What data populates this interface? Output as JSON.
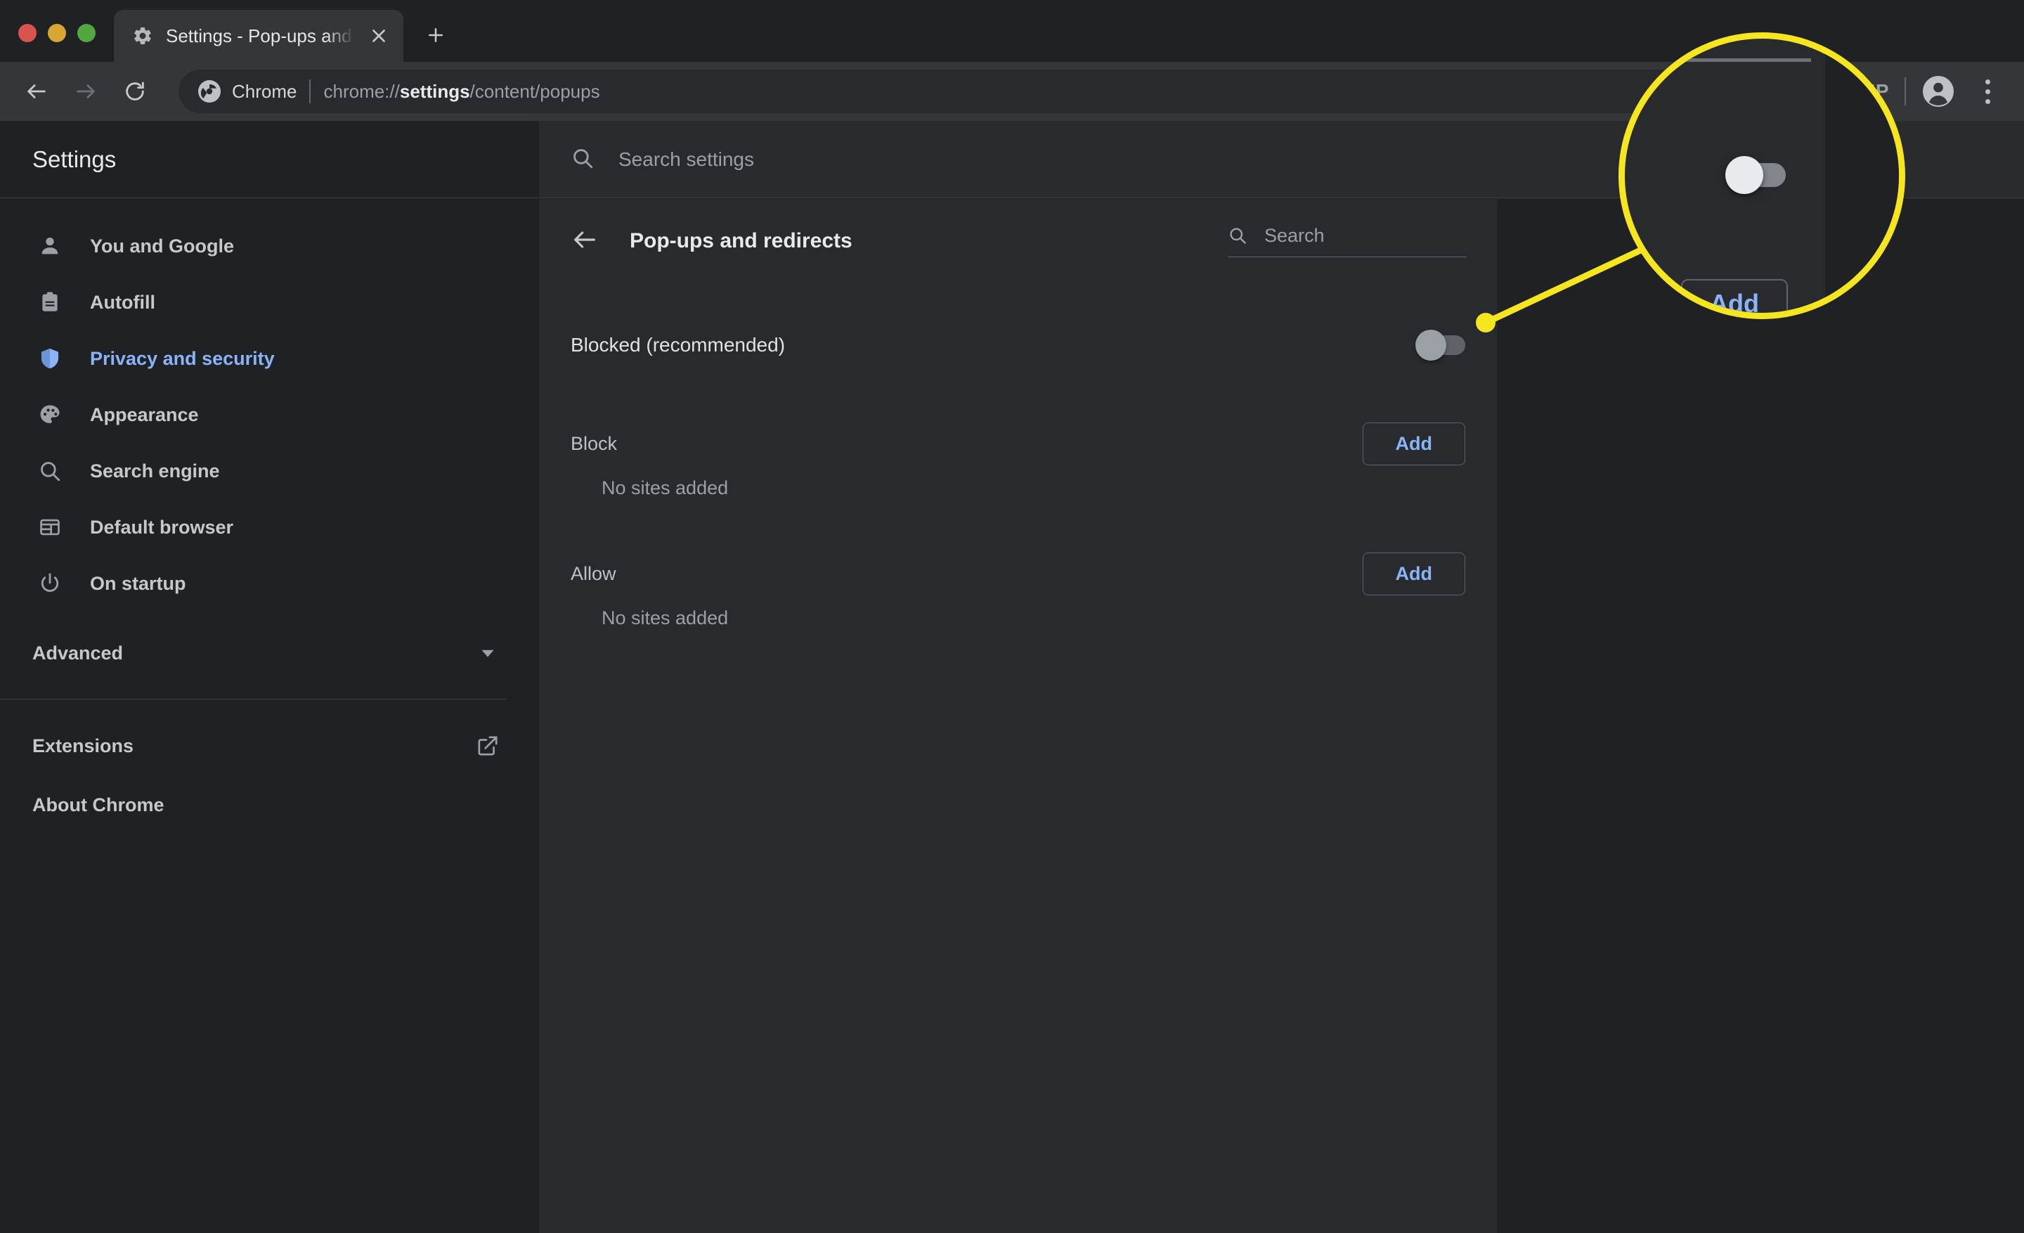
{
  "window": {
    "traffic_lights": [
      "close",
      "minimize",
      "maximize"
    ],
    "tab": {
      "title": "Settings - Pop-ups and redirec",
      "favicon": "gear-icon",
      "close_label": "✕"
    },
    "new_tab_label": "+"
  },
  "toolbar": {
    "back": "←",
    "forward": "→",
    "reload": "↻",
    "omnibox": {
      "chip_label": "Chrome",
      "url_prefix": "chrome://",
      "url_bold": "settings",
      "url_suffix": "/content/popups"
    },
    "profile_initials": "NP",
    "avatar": "account-circle-icon",
    "menu": "three-dot-menu-icon"
  },
  "sidebar": {
    "title": "Settings",
    "items": [
      {
        "label": "You and Google",
        "icon": "person-icon",
        "active": false
      },
      {
        "label": "Autofill",
        "icon": "clipboard-icon",
        "active": false
      },
      {
        "label": "Privacy and security",
        "icon": "shield-icon",
        "active": true
      },
      {
        "label": "Appearance",
        "icon": "palette-icon",
        "active": false
      },
      {
        "label": "Search engine",
        "icon": "search-icon",
        "active": false
      },
      {
        "label": "Default browser",
        "icon": "browser-window-icon",
        "active": false
      },
      {
        "label": "On startup",
        "icon": "power-icon",
        "active": false
      }
    ],
    "advanced": {
      "label": "Advanced",
      "icon": "chevron-down-icon"
    },
    "footer": [
      {
        "label": "Extensions",
        "icon": "external-link-icon"
      },
      {
        "label": "About Chrome",
        "icon": null
      }
    ]
  },
  "main": {
    "search_settings_placeholder": "Search settings",
    "search_settings_icon": "search-icon",
    "back_icon": "arrow-left-icon",
    "page_title": "Pop-ups and redirects",
    "page_search": {
      "placeholder": "Search",
      "icon": "search-icon"
    },
    "primary_setting": {
      "label": "Blocked (recommended)",
      "toggle_state": "off"
    },
    "groups": [
      {
        "label": "Block",
        "add_label": "Add",
        "empty_text": "No sites added"
      },
      {
        "label": "Allow",
        "add_label": "Add",
        "empty_text": "No sites added"
      }
    ]
  },
  "callout": {
    "accent_color": "#f5e620",
    "magnified_subject": "blocked-recommended-toggle",
    "magnified_toggle_state": "off",
    "magnified_add_label": "Add"
  },
  "colors": {
    "page_bg": "#202124",
    "card_bg": "#292a2d",
    "toolbar_bg": "#35363a",
    "accent_blue": "#8ab4f8",
    "text_primary": "#e8eaed",
    "text_secondary": "#9aa0a6",
    "highlight_yellow": "#f5e620"
  }
}
